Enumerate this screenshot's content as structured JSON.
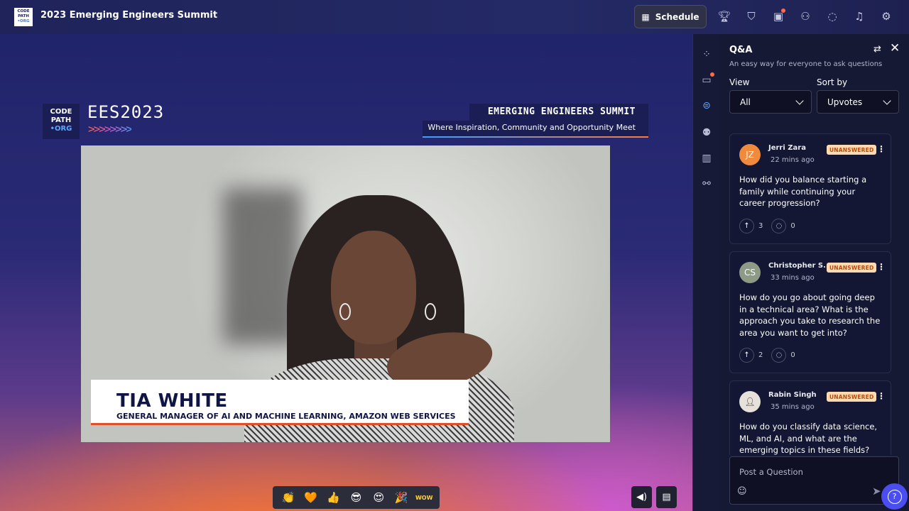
{
  "header": {
    "logo_lines": [
      "CODE",
      "PATH",
      "•ORG"
    ],
    "title": "2023 Emerging Engineers Summit",
    "schedule_label": "Schedule",
    "icons": [
      "trophy-icon",
      "shield-icon",
      "badge-id-icon",
      "people-icon",
      "chat-bubble-icon",
      "bell-icon",
      "gear-icon"
    ]
  },
  "stage": {
    "logo_lines": [
      "CODE",
      "PATH",
      "•ORG"
    ],
    "event_logo_text": "EES2023",
    "event_arrows": ">>>>>>>>",
    "banner_title": "EMERGING ENGINEERS SUMMIT",
    "banner_tagline": "Where Inspiration, Community and Opportunity Meet",
    "speaker_name": "TIA WHITE",
    "speaker_role": "GENERAL MANAGER OF AI AND MACHINE LEARNING, AMAZON WEB SERVICES",
    "reactions": [
      "👏",
      "🧡",
      "👍",
      "😎",
      "😍",
      "🎉",
      "WOW"
    ],
    "volume_icon": "speaker-icon",
    "screen_icon": "clipboard-icon"
  },
  "rail": {
    "icons": [
      "apps-icon",
      "chat-rooms-icon",
      "qa-icon",
      "people-group-icon",
      "poll-chart-icon",
      "handshake-icon"
    ]
  },
  "qa": {
    "title": "Q&A",
    "subtitle": "An easy way for everyone to ask questions",
    "view_label": "View",
    "view_value": "All",
    "sort_label": "Sort by",
    "sort_value": "Upvotes",
    "questions": [
      {
        "initials": "JZ",
        "avatar_color": "#f08a3c",
        "name": "Jerri Zara",
        "time": "22 mins ago",
        "status": "UNANSWERED",
        "text": "How did you balance starting a family while continuing your career progression?",
        "upvotes": "3",
        "replies": "0"
      },
      {
        "initials": "CS",
        "avatar_color": "#8f9a86",
        "name": "Christopher S...",
        "time": "33 mins ago",
        "status": "UNANSWERED",
        "text": "How do you go about going deep in a technical area? What is the approach you take to research the area you want to get into?",
        "upvotes": "2",
        "replies": "0"
      },
      {
        "initials": "RS",
        "avatar_color": "#d8d2cc",
        "name": "Rabin Singh",
        "time": "35 mins ago",
        "status": "UNANSWERED",
        "text": "How do you classify data science, ML, and AI, and what are the emerging topics in these fields?",
        "upvotes": "",
        "replies": ""
      }
    ],
    "post_placeholder": "Post a Question"
  },
  "colors": {
    "accent": "#4a4df0",
    "badge_bg": "#ffd9b0",
    "badge_text": "#b24d12"
  }
}
